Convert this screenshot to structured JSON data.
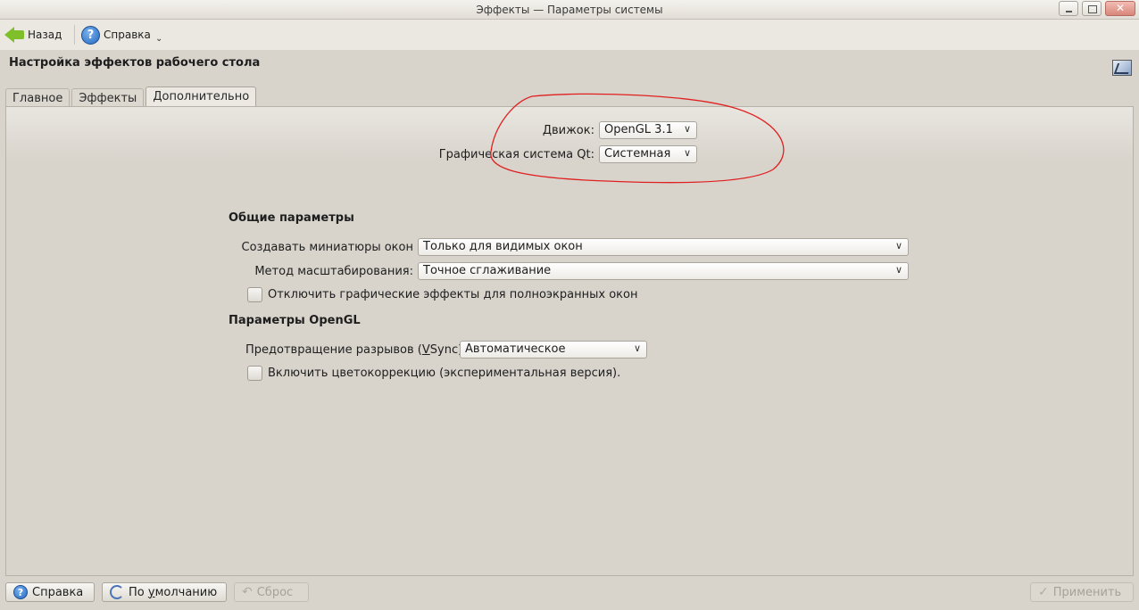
{
  "window": {
    "title": "Эффекты — Параметры системы"
  },
  "toolbar": {
    "back_label": "Назад",
    "help_label": "Справка"
  },
  "header": {
    "title": "Настройка эффектов рабочего стола"
  },
  "tabs": [
    {
      "label": "Главное",
      "active": false
    },
    {
      "label": "Эффекты",
      "active": false
    },
    {
      "label": "Дополнительно",
      "active": true
    }
  ],
  "advanced": {
    "engine_label": "Движок:",
    "engine_value": "OpenGL 3.1",
    "qt_graphics_label": "Графическая система Qt:",
    "qt_graphics_value": "Системная",
    "general_section": "Общие параметры",
    "thumbnails_label": "Создавать миниатюры окон",
    "thumbnails_value": "Только для видимых окон",
    "scale_label": "Метод масштабирования:",
    "scale_value": "Точное сглаживание",
    "disable_fullscreen_label": "Отключить графические эффекты для полноэкранных окон",
    "disable_fullscreen_checked": false,
    "opengl_section": "Параметры OpenGL",
    "vsync_label_pre": "Предотвращение разрывов (",
    "vsync_label_u": "V",
    "vsync_label_post": "Sync)",
    "vsync_value": "Автоматическое",
    "color_correction_label": "Включить цветокоррекцию (экспериментальная версия).",
    "color_correction_checked": false
  },
  "buttons": {
    "help": "Справка",
    "defaults_u": "у",
    "defaults_pre": "По ",
    "defaults_post": "молчанию",
    "reset": "Сброс",
    "apply": "Применить"
  },
  "colors": {
    "annotation_circle": "#e02020",
    "help_icon": "#2468bf",
    "back_arrow": "#7fbf2a"
  }
}
